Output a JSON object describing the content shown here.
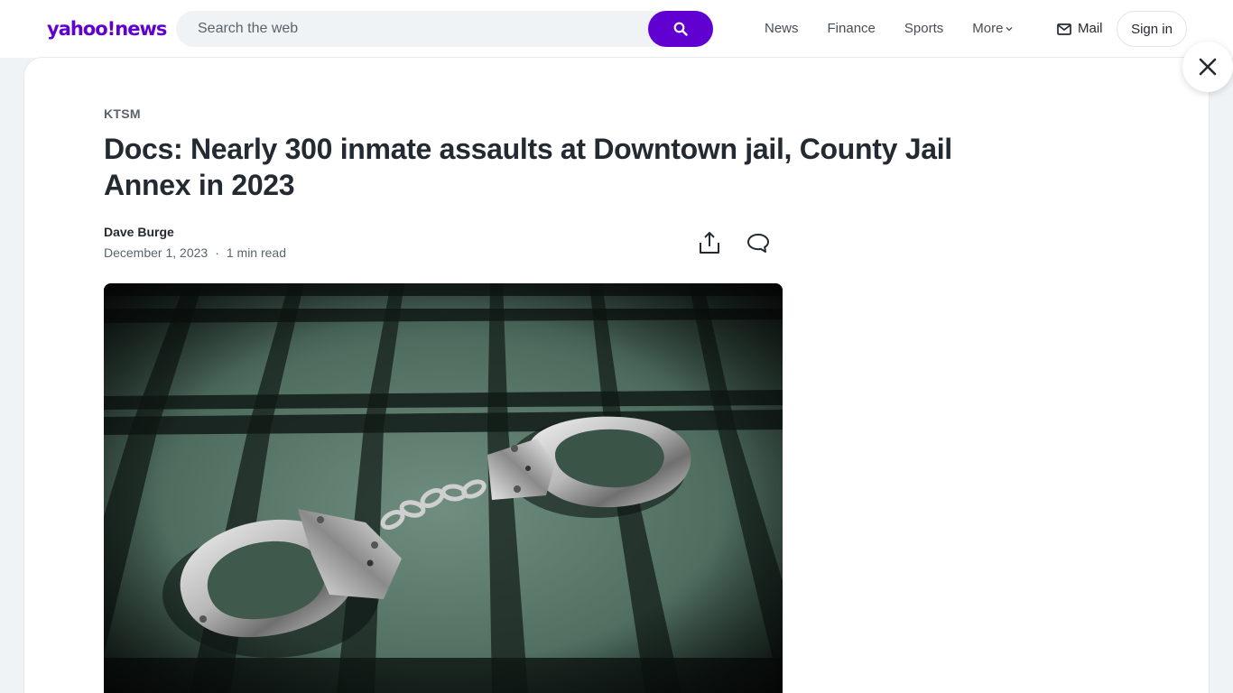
{
  "header": {
    "logo_main": "yahoo!",
    "logo_sub": "news",
    "search_placeholder": "Search the web",
    "nav": [
      {
        "label": "News"
      },
      {
        "label": "Finance"
      },
      {
        "label": "Sports"
      },
      {
        "label": "More"
      }
    ],
    "mail_label": "Mail",
    "signin_label": "Sign in"
  },
  "article": {
    "provider": "KTSM",
    "title": "Docs: Nearly 300 inmate assaults at Downtown jail, County Jail Annex in 2023",
    "author": "Dave Burge",
    "date": "December 1, 2023",
    "separator": "·",
    "read_time": "1 min read"
  },
  "colors": {
    "brand": "#6001d2",
    "text": "#232a31",
    "muted": "#5b636a",
    "page_bg": "#f0f3f5"
  },
  "icons": {
    "search": "search-icon",
    "mail": "mail-icon",
    "close": "close-icon",
    "share": "share-icon",
    "comment": "comment-icon",
    "chevron": "chevron-down-icon"
  }
}
